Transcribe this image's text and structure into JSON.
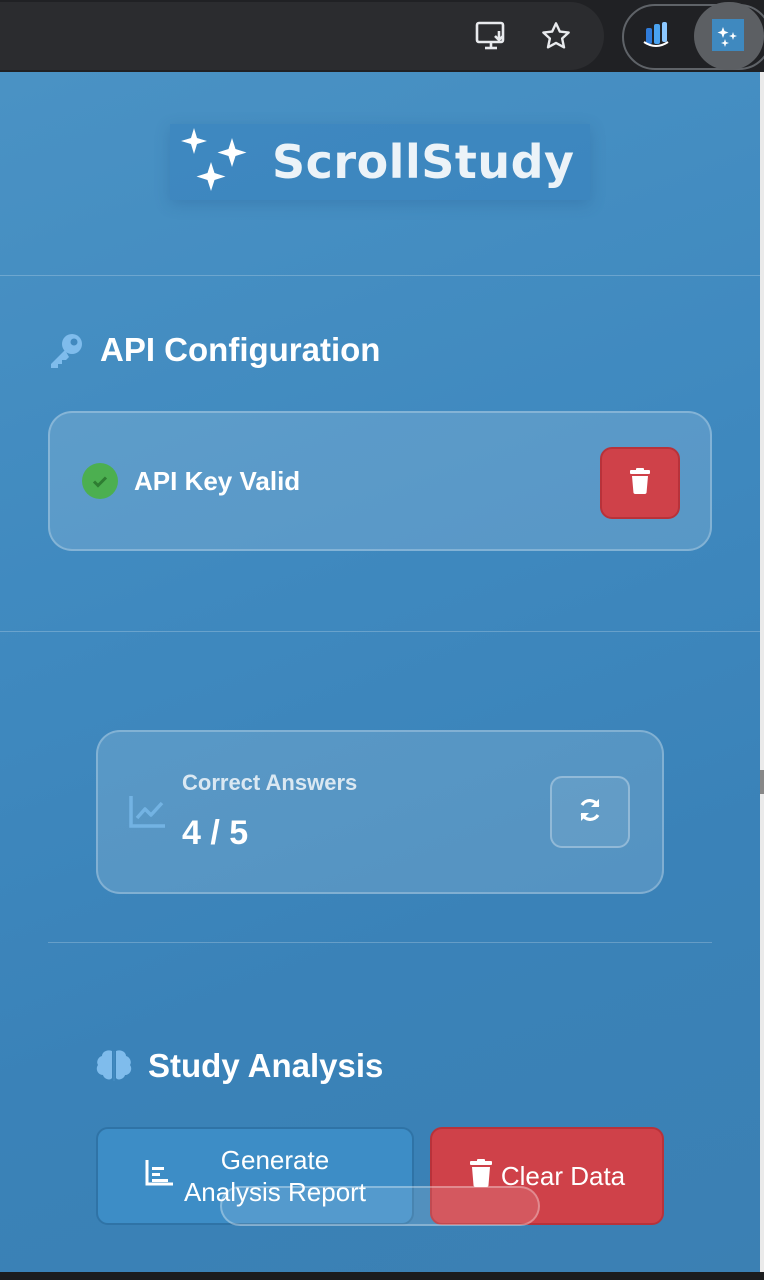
{
  "toolbar": {
    "icons": [
      "install-app-icon",
      "bookmark-star-icon",
      "extension-icon",
      "scrollstudy-extension-icon"
    ]
  },
  "brand": {
    "name": "ScrollStudy",
    "icon": "sparkles-icon"
  },
  "api_section": {
    "title": "API Configuration",
    "icon": "key-icon",
    "status_text": "API Key Valid",
    "status_icon": "check-circle-icon",
    "delete_icon": "trash-icon"
  },
  "stats": {
    "label": "Correct Answers",
    "value": "4 / 5",
    "icon": "chart-line-icon",
    "refresh_icon": "refresh-icon"
  },
  "analysis_section": {
    "title": "Study Analysis",
    "icon": "brain-icon",
    "generate_line1": "Generate",
    "generate_line2": "Analysis Report",
    "generate_icon": "bar-chart-icon",
    "clear_label": "Clear Data",
    "clear_icon": "trash-icon"
  },
  "colors": {
    "panel": "#4189bf",
    "danger": "#cf4149",
    "success": "#4caf50",
    "button_blue": "#3d8dc6"
  }
}
